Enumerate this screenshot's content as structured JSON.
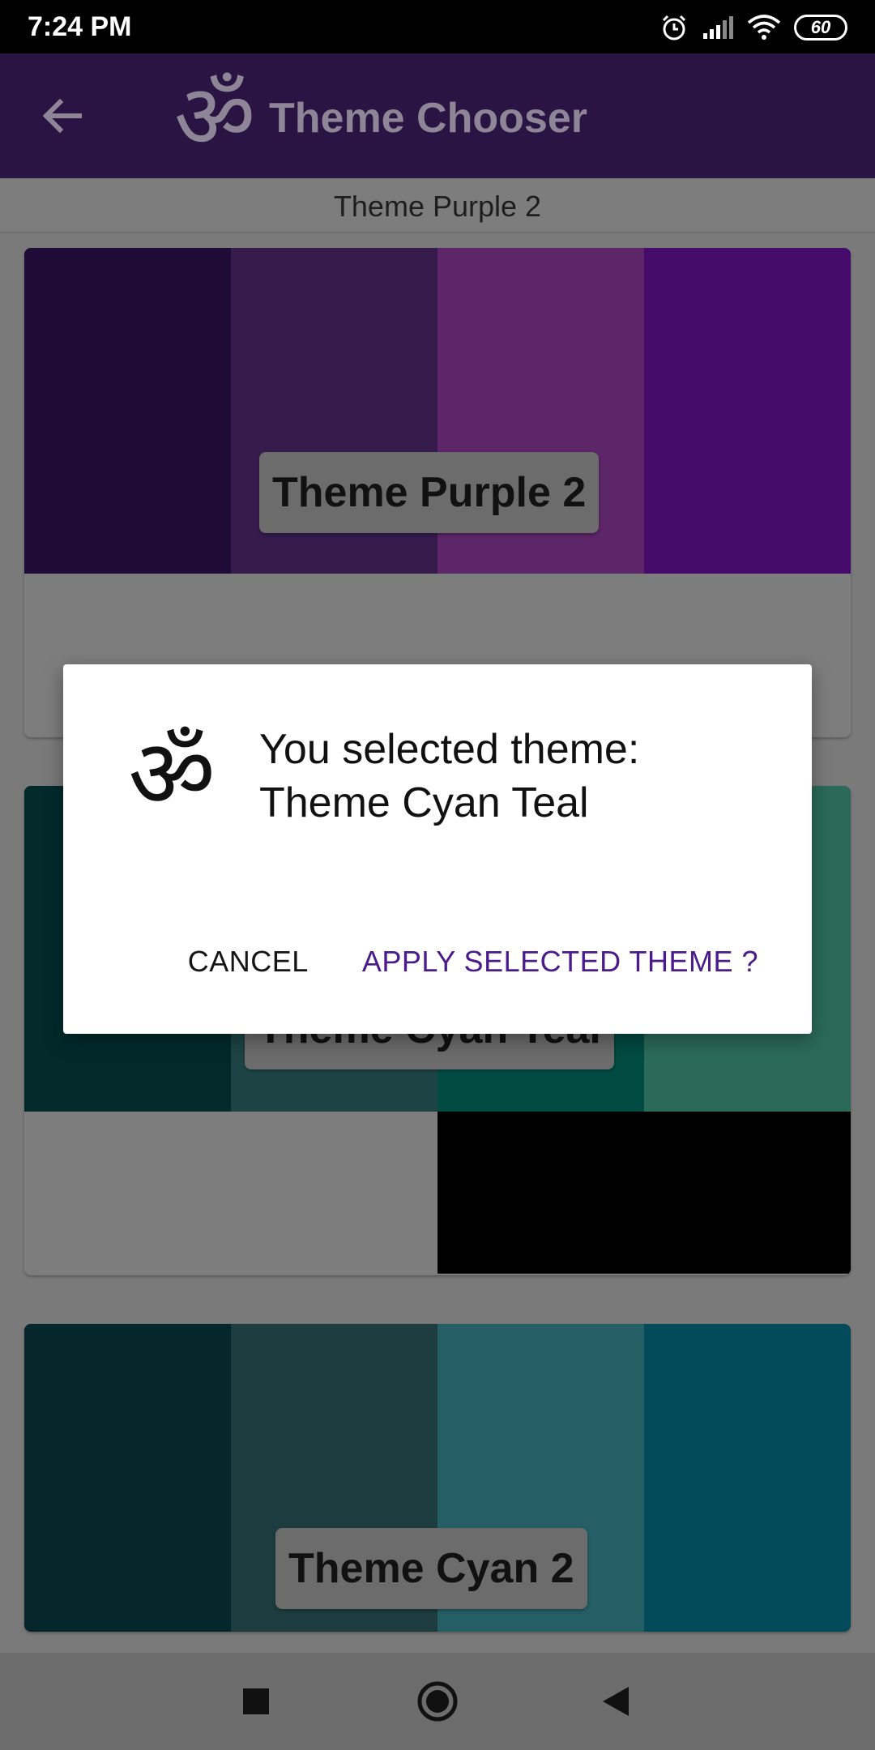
{
  "status_bar": {
    "time": "7:24 PM",
    "battery": "60",
    "icons": [
      "alarm-icon",
      "signal-icon",
      "wifi-icon",
      "battery-icon"
    ]
  },
  "app_bar": {
    "title": "Theme Chooser",
    "back_icon": "arrow-left-icon",
    "logo_icon": "om-icon",
    "logo_glyph": "ॐ",
    "background": "#2a1443"
  },
  "subheader": {
    "current_theme": "Theme Purple 2"
  },
  "themes": [
    {
      "name": "Theme Purple 2",
      "colors": [
        "#1e0b36",
        "#351c4d",
        "#5c2669",
        "#440b6b"
      ]
    },
    {
      "name": "Theme Cyan Teal",
      "colors": [
        "#022a2b",
        "#1d4444",
        "#024b42",
        "#2b6a59"
      ]
    },
    {
      "name": "Theme Cyan 2",
      "colors": [
        "#05272b",
        "#1c3c3f",
        "#265e66",
        "#034b5a"
      ]
    }
  ],
  "dialog": {
    "icon": "om-icon",
    "icon_glyph": "ॐ",
    "message_line1": "You selected theme:",
    "message_line2": "Theme Cyan Teal",
    "cancel_label": "CANCEL",
    "apply_label": "APPLY SELECTED THEME ?",
    "accent_color": "#4b1b8c"
  },
  "nav_bar": {
    "buttons": [
      "recents-square-icon",
      "home-circle-icon",
      "back-triangle-icon"
    ]
  }
}
